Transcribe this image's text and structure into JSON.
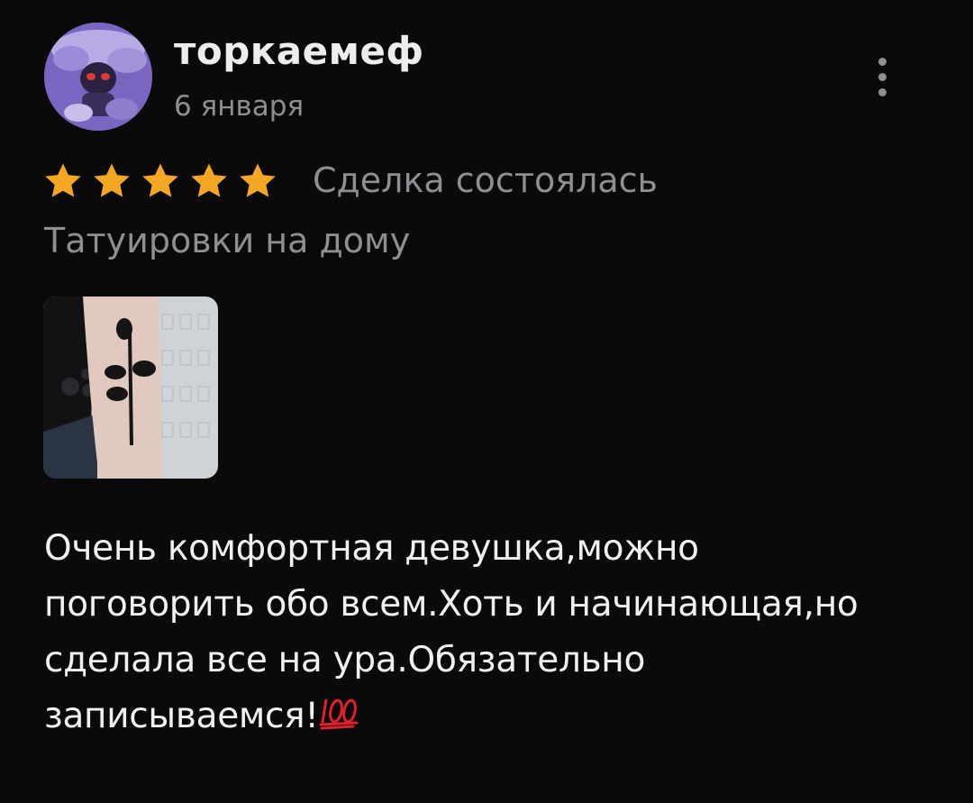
{
  "review": {
    "author": {
      "name": "торкаемеф",
      "avatar_icon": "avatar-photo"
    },
    "date": "6 января",
    "menu_icon": "more-vertical-icon",
    "rating": {
      "value": 5,
      "max": 5,
      "star_color": "#f5a623"
    },
    "status": "Сделка состоялась",
    "service": "Татуировки на дому",
    "photo": {
      "icon": "tattoo-photo-thumbnail"
    },
    "text_lines": [
      "Очень комфортная девушка,можно",
      "поговорить обо всем.Хоть и начинающая,но",
      "сделала все на ура.Обязательно",
      "записываемся!"
    ],
    "emoji": "hundred-points-icon",
    "colors": {
      "background": "#0a0a0b",
      "primary_text": "#f0f0f0",
      "secondary_text": "#8e8e93",
      "emoji_red": "#e0202c"
    }
  }
}
